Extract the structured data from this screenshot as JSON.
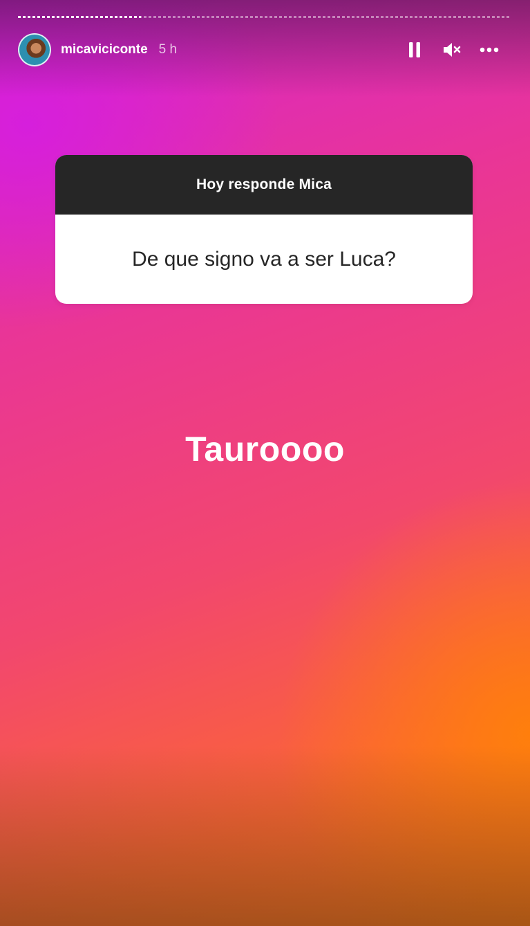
{
  "story": {
    "progress": 0.25,
    "header": {
      "username": "micaviciconte",
      "time": "5 h",
      "icons": [
        "avatar",
        "pause-icon",
        "mute-icon",
        "more-icon"
      ]
    },
    "question_sticker": {
      "title": "Hoy responde Mica",
      "question": "De que signo va a ser Luca?"
    },
    "answer": "Tauroooo"
  },
  "colors": {
    "gradient_top_left": "#d524cf",
    "gradient_bottom_right": "#ff7a1a",
    "sticker_header": "#262626",
    "sticker_body": "#ffffff"
  }
}
